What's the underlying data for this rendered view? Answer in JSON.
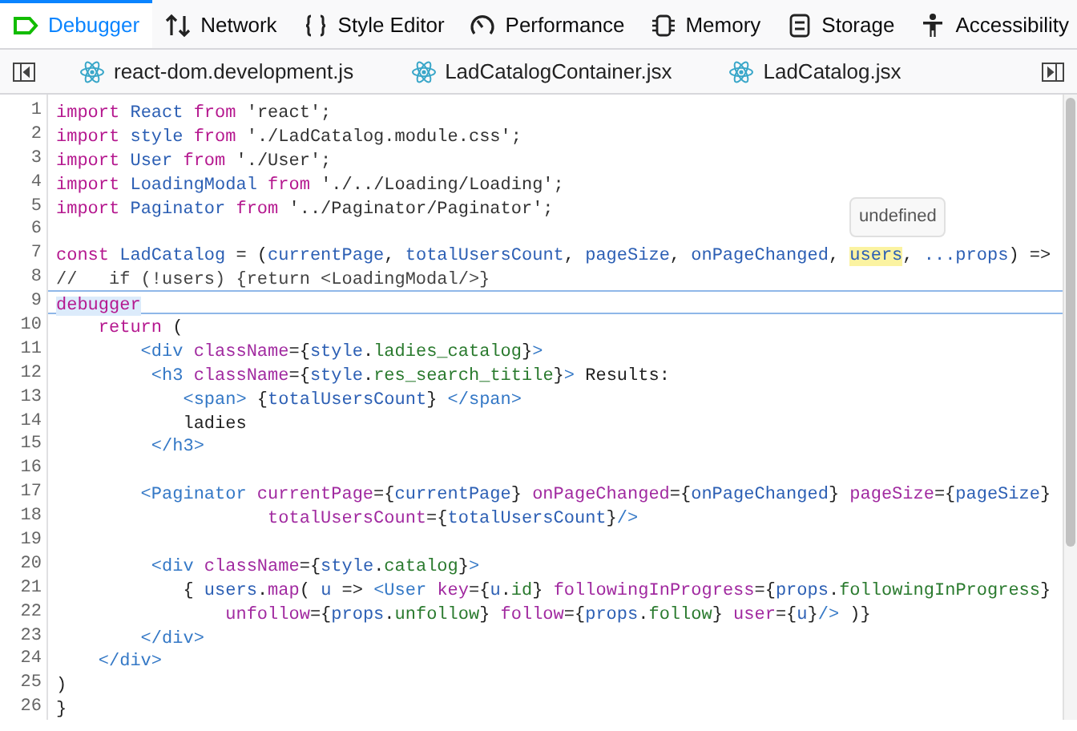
{
  "toolbox_tabs": [
    {
      "label": "Debugger",
      "selected": true
    },
    {
      "label": "Network",
      "selected": false
    },
    {
      "label": "Style Editor",
      "selected": false
    },
    {
      "label": "Performance",
      "selected": false
    },
    {
      "label": "Memory",
      "selected": false
    },
    {
      "label": "Storage",
      "selected": false
    },
    {
      "label": "Accessibility",
      "selected": false
    }
  ],
  "source_tabs": [
    {
      "label": "react-dom.development.js"
    },
    {
      "label": "LadCatalogContainer.jsx"
    },
    {
      "label": "LadCatalog.jsx"
    }
  ],
  "editor": {
    "tooltip": "undefined",
    "lines": [
      {
        "number": "1",
        "paused": false,
        "tokens": [
          {
            "kind": "kw",
            "text": "import "
          },
          {
            "kind": "id",
            "text": "React "
          },
          {
            "kind": "kw",
            "text": "from "
          },
          {
            "kind": "str",
            "text": "'react';"
          }
        ]
      },
      {
        "number": "2",
        "paused": false,
        "tokens": [
          {
            "kind": "kw",
            "text": "import "
          },
          {
            "kind": "id",
            "text": "style "
          },
          {
            "kind": "kw",
            "text": "from "
          },
          {
            "kind": "str",
            "text": "'./LadCatalog.module.css';"
          }
        ]
      },
      {
        "number": "3",
        "paused": false,
        "tokens": [
          {
            "kind": "kw",
            "text": "import "
          },
          {
            "kind": "id",
            "text": "User "
          },
          {
            "kind": "kw",
            "text": "from "
          },
          {
            "kind": "str",
            "text": "'./User';"
          }
        ]
      },
      {
        "number": "4",
        "paused": false,
        "tokens": [
          {
            "kind": "kw",
            "text": "import "
          },
          {
            "kind": "id",
            "text": "LoadingModal "
          },
          {
            "kind": "kw",
            "text": "from "
          },
          {
            "kind": "str",
            "text": "'./../Loading/Loading';"
          }
        ]
      },
      {
        "number": "5",
        "paused": false,
        "tokens": [
          {
            "kind": "kw",
            "text": "import "
          },
          {
            "kind": "id",
            "text": "Paginator "
          },
          {
            "kind": "kw",
            "text": "from "
          },
          {
            "kind": "str",
            "text": "'../Paginator/Paginator';"
          }
        ]
      },
      {
        "number": "6",
        "paused": false
      },
      {
        "number": "7",
        "paused": false,
        "tokens": [
          {
            "kind": "kw",
            "text": "const "
          },
          {
            "kind": "id",
            "text": "LadCatalog "
          },
          {
            "kind": "plain",
            "text": "= ("
          },
          {
            "kind": "id",
            "text": "currentPage"
          },
          {
            "kind": "plain",
            "text": ", "
          },
          {
            "kind": "id",
            "text": "totalUsersCount"
          },
          {
            "kind": "plain",
            "text": ", "
          },
          {
            "kind": "id",
            "text": "pageSize"
          },
          {
            "kind": "plain",
            "text": ", "
          },
          {
            "kind": "id",
            "text": "onPageChanged"
          },
          {
            "kind": "plain",
            "text": ", "
          },
          {
            "kind": "hover",
            "text": "users"
          },
          {
            "kind": "plain",
            "text": ", "
          },
          {
            "kind": "id",
            "text": "...props"
          },
          {
            "kind": "plain",
            "text": ") =>"
          }
        ]
      },
      {
        "number": "8",
        "paused": false,
        "tokens": [
          {
            "kind": "comment",
            "text": "//   if (!users) {return <LoadingModal/>}"
          }
        ]
      },
      {
        "number": "9",
        "paused": true,
        "tokens": [
          {
            "kind": "kw",
            "text": "debugger"
          }
        ]
      },
      {
        "number": "10",
        "paused": false,
        "tokens": [
          {
            "kind": "kw",
            "text": "    return "
          },
          {
            "kind": "plain",
            "text": "("
          }
        ]
      },
      {
        "number": "11",
        "paused": false,
        "tokens": [
          {
            "kind": "tag",
            "text": "        <div "
          },
          {
            "kind": "attr",
            "text": "className"
          },
          {
            "kind": "plain",
            "text": "={"
          },
          {
            "kind": "id",
            "text": "style"
          },
          {
            "kind": "plain",
            "text": "."
          },
          {
            "kind": "prop",
            "text": "ladies_catalog"
          },
          {
            "kind": "plain",
            "text": "}"
          },
          {
            "kind": "tag",
            "text": ">"
          }
        ]
      },
      {
        "number": "12",
        "paused": false,
        "tokens": [
          {
            "kind": "tag",
            "text": "         <h3 "
          },
          {
            "kind": "attr",
            "text": "className"
          },
          {
            "kind": "plain",
            "text": "={"
          },
          {
            "kind": "id",
            "text": "style"
          },
          {
            "kind": "plain",
            "text": "."
          },
          {
            "kind": "prop",
            "text": "res_search_titile"
          },
          {
            "kind": "plain",
            "text": "}"
          },
          {
            "kind": "tag",
            "text": ">"
          },
          {
            "kind": "plain",
            "text": " Results:"
          }
        ]
      },
      {
        "number": "13",
        "paused": false,
        "tokens": [
          {
            "kind": "tag",
            "text": "            <span>"
          },
          {
            "kind": "plain",
            "text": " {"
          },
          {
            "kind": "id",
            "text": "totalUsersCount"
          },
          {
            "kind": "plain",
            "text": "} "
          },
          {
            "kind": "tag",
            "text": "</span>"
          }
        ]
      },
      {
        "number": "14",
        "paused": false,
        "tokens": [
          {
            "kind": "plain",
            "text": "            ladies"
          }
        ]
      },
      {
        "number": "15",
        "paused": false,
        "tokens": [
          {
            "kind": "tag",
            "text": "         </h3>"
          }
        ]
      },
      {
        "number": "16",
        "paused": false
      },
      {
        "number": "17",
        "paused": false,
        "tokens": [
          {
            "kind": "tag",
            "text": "        <Paginator "
          },
          {
            "kind": "attr",
            "text": "currentPage"
          },
          {
            "kind": "plain",
            "text": "={"
          },
          {
            "kind": "id",
            "text": "currentPage"
          },
          {
            "kind": "plain",
            "text": "} "
          },
          {
            "kind": "attr",
            "text": "onPageChanged"
          },
          {
            "kind": "plain",
            "text": "={"
          },
          {
            "kind": "id",
            "text": "onPageChanged"
          },
          {
            "kind": "plain",
            "text": "} "
          },
          {
            "kind": "attr",
            "text": "pageSize"
          },
          {
            "kind": "plain",
            "text": "={"
          },
          {
            "kind": "id",
            "text": "pageSize"
          },
          {
            "kind": "plain",
            "text": "}"
          }
        ]
      },
      {
        "number": "18",
        "paused": false,
        "tokens": [
          {
            "kind": "attr",
            "text": "                    totalUsersCount"
          },
          {
            "kind": "plain",
            "text": "={"
          },
          {
            "kind": "id",
            "text": "totalUsersCount"
          },
          {
            "kind": "plain",
            "text": "}"
          },
          {
            "kind": "tag",
            "text": "/>"
          }
        ]
      },
      {
        "number": "19",
        "paused": false
      },
      {
        "number": "20",
        "paused": false,
        "tokens": [
          {
            "kind": "tag",
            "text": "         <div "
          },
          {
            "kind": "attr",
            "text": "className"
          },
          {
            "kind": "plain",
            "text": "={"
          },
          {
            "kind": "id",
            "text": "style"
          },
          {
            "kind": "plain",
            "text": "."
          },
          {
            "kind": "prop",
            "text": "catalog"
          },
          {
            "kind": "plain",
            "text": "}"
          },
          {
            "kind": "tag",
            "text": ">"
          }
        ]
      },
      {
        "number": "21",
        "paused": false,
        "tokens": [
          {
            "kind": "plain",
            "text": "            { "
          },
          {
            "kind": "id",
            "text": "users"
          },
          {
            "kind": "plain",
            "text": "."
          },
          {
            "kind": "attr",
            "text": "map"
          },
          {
            "kind": "plain",
            "text": "( "
          },
          {
            "kind": "id",
            "text": "u"
          },
          {
            "kind": "plain",
            "text": " => "
          },
          {
            "kind": "tag",
            "text": "<User "
          },
          {
            "kind": "attr",
            "text": "key"
          },
          {
            "kind": "plain",
            "text": "={"
          },
          {
            "kind": "id",
            "text": "u"
          },
          {
            "kind": "plain",
            "text": "."
          },
          {
            "kind": "prop",
            "text": "id"
          },
          {
            "kind": "plain",
            "text": "} "
          },
          {
            "kind": "attr",
            "text": "followingInProgress"
          },
          {
            "kind": "plain",
            "text": "={"
          },
          {
            "kind": "id",
            "text": "props"
          },
          {
            "kind": "plain",
            "text": "."
          },
          {
            "kind": "prop",
            "text": "followingInProgress"
          },
          {
            "kind": "plain",
            "text": "}"
          }
        ]
      },
      {
        "number": "22",
        "paused": false,
        "tokens": [
          {
            "kind": "attr",
            "text": "                unfollow"
          },
          {
            "kind": "plain",
            "text": "={"
          },
          {
            "kind": "id",
            "text": "props"
          },
          {
            "kind": "plain",
            "text": "."
          },
          {
            "kind": "prop",
            "text": "unfollow"
          },
          {
            "kind": "plain",
            "text": "} "
          },
          {
            "kind": "attr",
            "text": "follow"
          },
          {
            "kind": "plain",
            "text": "={"
          },
          {
            "kind": "id",
            "text": "props"
          },
          {
            "kind": "plain",
            "text": "."
          },
          {
            "kind": "prop",
            "text": "follow"
          },
          {
            "kind": "plain",
            "text": "} "
          },
          {
            "kind": "attr",
            "text": "user"
          },
          {
            "kind": "plain",
            "text": "={"
          },
          {
            "kind": "id",
            "text": "u"
          },
          {
            "kind": "plain",
            "text": "}"
          },
          {
            "kind": "tag",
            "text": "/>"
          },
          {
            "kind": "plain",
            "text": " )}"
          }
        ]
      },
      {
        "number": "23",
        "paused": false,
        "tokens": [
          {
            "kind": "tag",
            "text": "        </div>"
          }
        ]
      },
      {
        "number": "24",
        "paused": false,
        "tokens": [
          {
            "kind": "tag",
            "text": "    </div>"
          }
        ]
      },
      {
        "number": "25",
        "paused": false,
        "tokens": [
          {
            "kind": "plain",
            "text": ")"
          }
        ]
      },
      {
        "number": "26",
        "paused": false,
        "tokens": [
          {
            "kind": "plain",
            "text": "}"
          }
        ]
      }
    ]
  }
}
